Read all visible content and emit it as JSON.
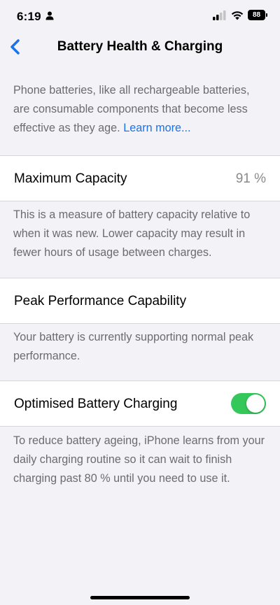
{
  "status": {
    "time": "6:19",
    "battery_level": "88",
    "icons": [
      "person-icon",
      "signal-icon",
      "wifi-icon",
      "battery-icon"
    ]
  },
  "nav": {
    "back_icon": "chevron-left-icon",
    "title": "Battery Health & Charging"
  },
  "intro": {
    "text": "Phone batteries, like all rechargeable batteries, are consumable components that become less effective as they age.",
    "link": "Learn more..."
  },
  "capacity": {
    "label": "Maximum Capacity",
    "value": "91 %",
    "footnote": "This is a measure of battery capacity relative to when it was new. Lower capacity may result in fewer hours of usage between charges."
  },
  "peak": {
    "label": "Peak Performance Capability",
    "footnote": "Your battery is currently supporting normal peak performance."
  },
  "charging": {
    "label": "Optimised Battery Charging",
    "toggle_on": true,
    "footnote": "To reduce battery ageing, iPhone learns from your daily charging routine so it can wait to finish charging past 80 % until you need to use it."
  },
  "colors": {
    "accent": "#1a73e8",
    "toggle_on": "#34c759",
    "background": "#f2f2f7"
  }
}
